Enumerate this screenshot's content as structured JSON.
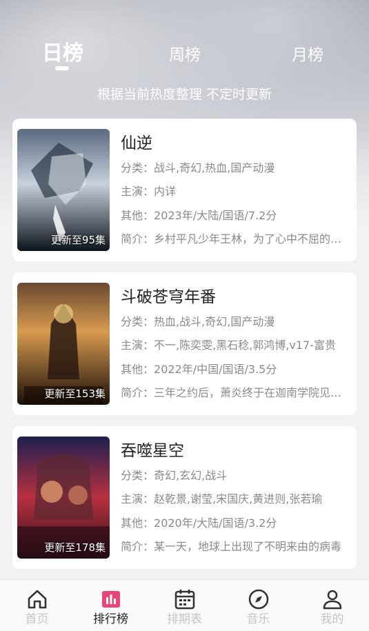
{
  "tabs": [
    {
      "label": "日榜",
      "active": true
    },
    {
      "label": "周榜",
      "active": false
    },
    {
      "label": "月榜",
      "active": false
    }
  ],
  "subtitle": "根据当前热度整理 不定时更新",
  "items": [
    {
      "title": "仙逆",
      "badge": "更新至95集",
      "category": {
        "label": "分类：",
        "value": "战斗,奇幻,热血,国产动漫"
      },
      "cast": {
        "label": "主演：",
        "value": "内详"
      },
      "other": {
        "label": "其他：",
        "value": "2023年/大陆/国语/7.2分"
      },
      "summary": {
        "label": "简介：",
        "value": "乡村平凡少年王林，为了心中不屈的执念"
      },
      "poster_colors": [
        "#1a2a3a",
        "#7a8aa0",
        "#d8dde6"
      ]
    },
    {
      "title": "斗破苍穹年番",
      "badge": "更新至153集",
      "category": {
        "label": "分类：",
        "value": "热血,战斗,奇幻,国产动漫"
      },
      "cast": {
        "label": "主演：",
        "value": "不一,陈奕雯,黑石稔,郭鸿博,v17-富贵"
      },
      "other": {
        "label": "其他：",
        "value": "2022年/中国/国语/3.5分"
      },
      "summary": {
        "label": "简介：",
        "value": "三年之约后，萧炎终于在迦南学院见到了"
      },
      "poster_colors": [
        "#3a2410",
        "#b8733a",
        "#f0c070"
      ]
    },
    {
      "title": "吞噬星空",
      "badge": "更新至178集",
      "category": {
        "label": "分类：",
        "value": "奇幻,玄幻,战斗"
      },
      "cast": {
        "label": "主演：",
        "value": "赵乾景,谢莹,宋国庆,黄进则,张若瑜"
      },
      "other": {
        "label": "其他：",
        "value": "2020年/大陆/国语/3.2分"
      },
      "summary": {
        "label": "简介：",
        "value": "某一天，地球上出现了不明来由的病毒"
      },
      "poster_colors": [
        "#1a1a40",
        "#a02030",
        "#e07040"
      ]
    }
  ],
  "nav": [
    {
      "label": "首页",
      "icon": "home-icon",
      "active": false
    },
    {
      "label": "排行榜",
      "icon": "ranking-icon",
      "active": true
    },
    {
      "label": "排期表",
      "icon": "calendar-icon",
      "active": false
    },
    {
      "label": "音乐",
      "icon": "compass-icon",
      "active": false
    },
    {
      "label": "我的",
      "icon": "user-icon",
      "active": false
    }
  ],
  "colors": {
    "accent": "#e8457a",
    "inactive": "#c4c4c4"
  }
}
